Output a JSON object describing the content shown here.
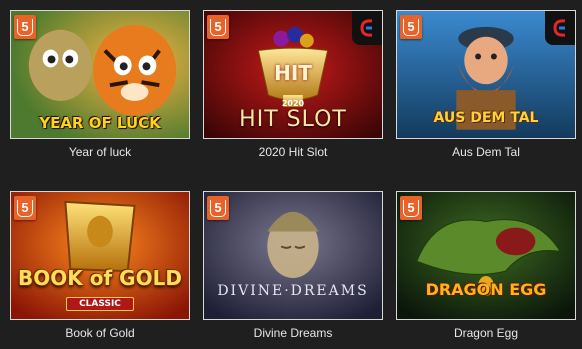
{
  "games": [
    {
      "title": "Year of luck",
      "badge": "5",
      "logo": "YEAR OF LUCK",
      "colors": {
        "bg1": "#3c6c2a",
        "bg2": "#f4a12b"
      }
    },
    {
      "title": "2020 Hit Slot",
      "badge": "5",
      "logo_top": "HIT",
      "logo_year": "2020",
      "logo": "HIT SLOT",
      "provider": true,
      "colors": {
        "bg1": "#a01010",
        "bg2": "#3a0505"
      }
    },
    {
      "title": "Aus Dem Tal",
      "badge": "5",
      "logo": "AUS DEM TAL",
      "provider": true,
      "colors": {
        "bg1": "#2c6fa8",
        "bg2": "#0f2c4a"
      }
    },
    {
      "title": "Book of Gold",
      "badge": "5",
      "logo": "BOOK of GOLD",
      "logo_sub": "CLASSIC",
      "colors": {
        "bg1": "#e85a10",
        "bg2": "#8a1505"
      }
    },
    {
      "title": "Divine Dreams",
      "badge": "5",
      "logo": "DIVINE·DREAMS",
      "colors": {
        "bg1": "#4a4a6a",
        "bg2": "#22223a"
      }
    },
    {
      "title": "Dragon Egg",
      "badge": "5",
      "logo": "DRAGON EGG",
      "colors": {
        "bg1": "#2a4a18",
        "bg2": "#0d1e0a"
      }
    }
  ]
}
